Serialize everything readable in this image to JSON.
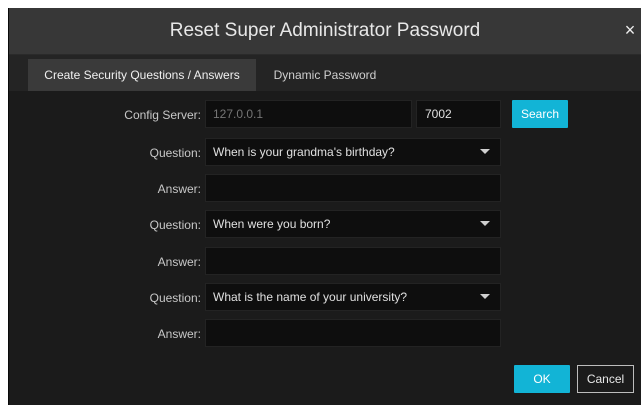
{
  "dialog": {
    "title": "Reset Super Administrator Password",
    "close_glyph": "×"
  },
  "tabs": [
    {
      "label": "Create Security Questions / Answers",
      "active": true
    },
    {
      "label": "Dynamic Password",
      "active": false
    }
  ],
  "config_server": {
    "label": "Config Server:",
    "ip_placeholder": "127.0.0.1",
    "ip_value": "",
    "port_value": "7002",
    "search_label": "Search"
  },
  "questions": [
    {
      "question_label": "Question:",
      "question_value": "When is your grandma's birthday?",
      "answer_label": "Answer:",
      "answer_value": ""
    },
    {
      "question_label": "Question:",
      "question_value": "When were you born?",
      "answer_label": "Answer:",
      "answer_value": ""
    },
    {
      "question_label": "Question:",
      "question_value": "What is the name of your university?",
      "answer_label": "Answer:",
      "answer_value": ""
    }
  ],
  "footer": {
    "ok_label": "OK",
    "cancel_label": "Cancel"
  },
  "colors": {
    "accent": "#12b4d6",
    "dialog_bg": "#1b1b1b",
    "titlebar_bg": "#373737"
  },
  "icons": {
    "close": "close-icon",
    "dropdown": "chevron-down-icon"
  }
}
